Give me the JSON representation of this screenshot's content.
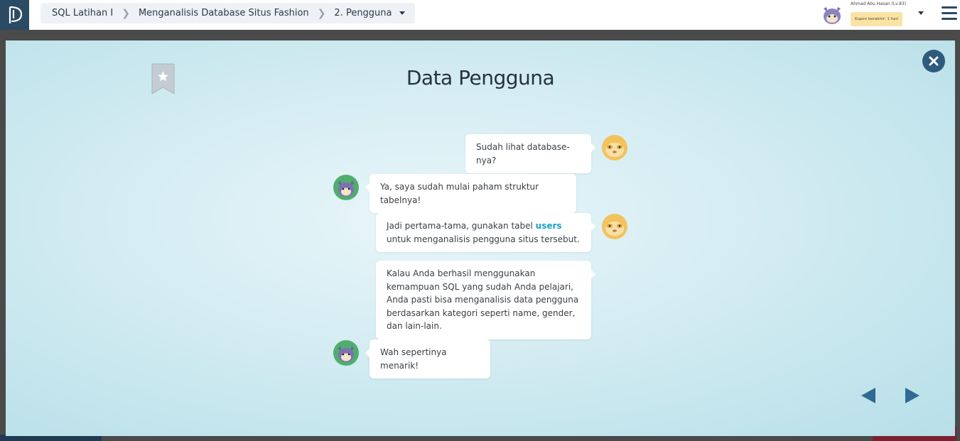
{
  "header": {
    "breadcrumbs": [
      "SQL Latihan I",
      "Menganalisis Database Situs Fashion",
      "2. Pengguna"
    ],
    "user_name": "Ahmad Abu Hasan (Lv.83)",
    "coupon_text": "Kupon berakhir: 1 hari"
  },
  "modal": {
    "title": "Data Pengguna",
    "messages": [
      {
        "speaker": "mentor",
        "side": "right",
        "text": "Sudah lihat database-nya?"
      },
      {
        "speaker": "student",
        "side": "left",
        "text": "Ya, saya sudah mulai paham struktur tabelnya!"
      },
      {
        "speaker": "mentor",
        "side": "right",
        "text_before": "Jadi pertama-tama, gunakan tabel",
        "highlight": "users",
        "text_after": "untuk menganalisis pengguna situs tersebut."
      },
      {
        "speaker": "mentor",
        "side": "right",
        "text": "Kalau Anda berhasil menggunakan kemampuan SQL yang sudah Anda pelajari, Anda pasti bisa menganalisis data pengguna berdasarkan kategori seperti name, gender, dan lain-lain."
      },
      {
        "speaker": "student",
        "side": "left",
        "text": "Wah sepertinya menarik!"
      }
    ]
  },
  "icons": {
    "logo": "progate-logo-icon",
    "bookmark": "bookmark-star-icon",
    "close": "close-icon",
    "prev": "previous-arrow-icon",
    "next": "next-arrow-icon",
    "menu": "hamburger-menu-icon"
  },
  "colors": {
    "accent": "#1aa3c7",
    "nav_dark": "#2b4a63",
    "close_bg": "#2e5b7d",
    "coupon_bg": "#fbe3a5"
  }
}
